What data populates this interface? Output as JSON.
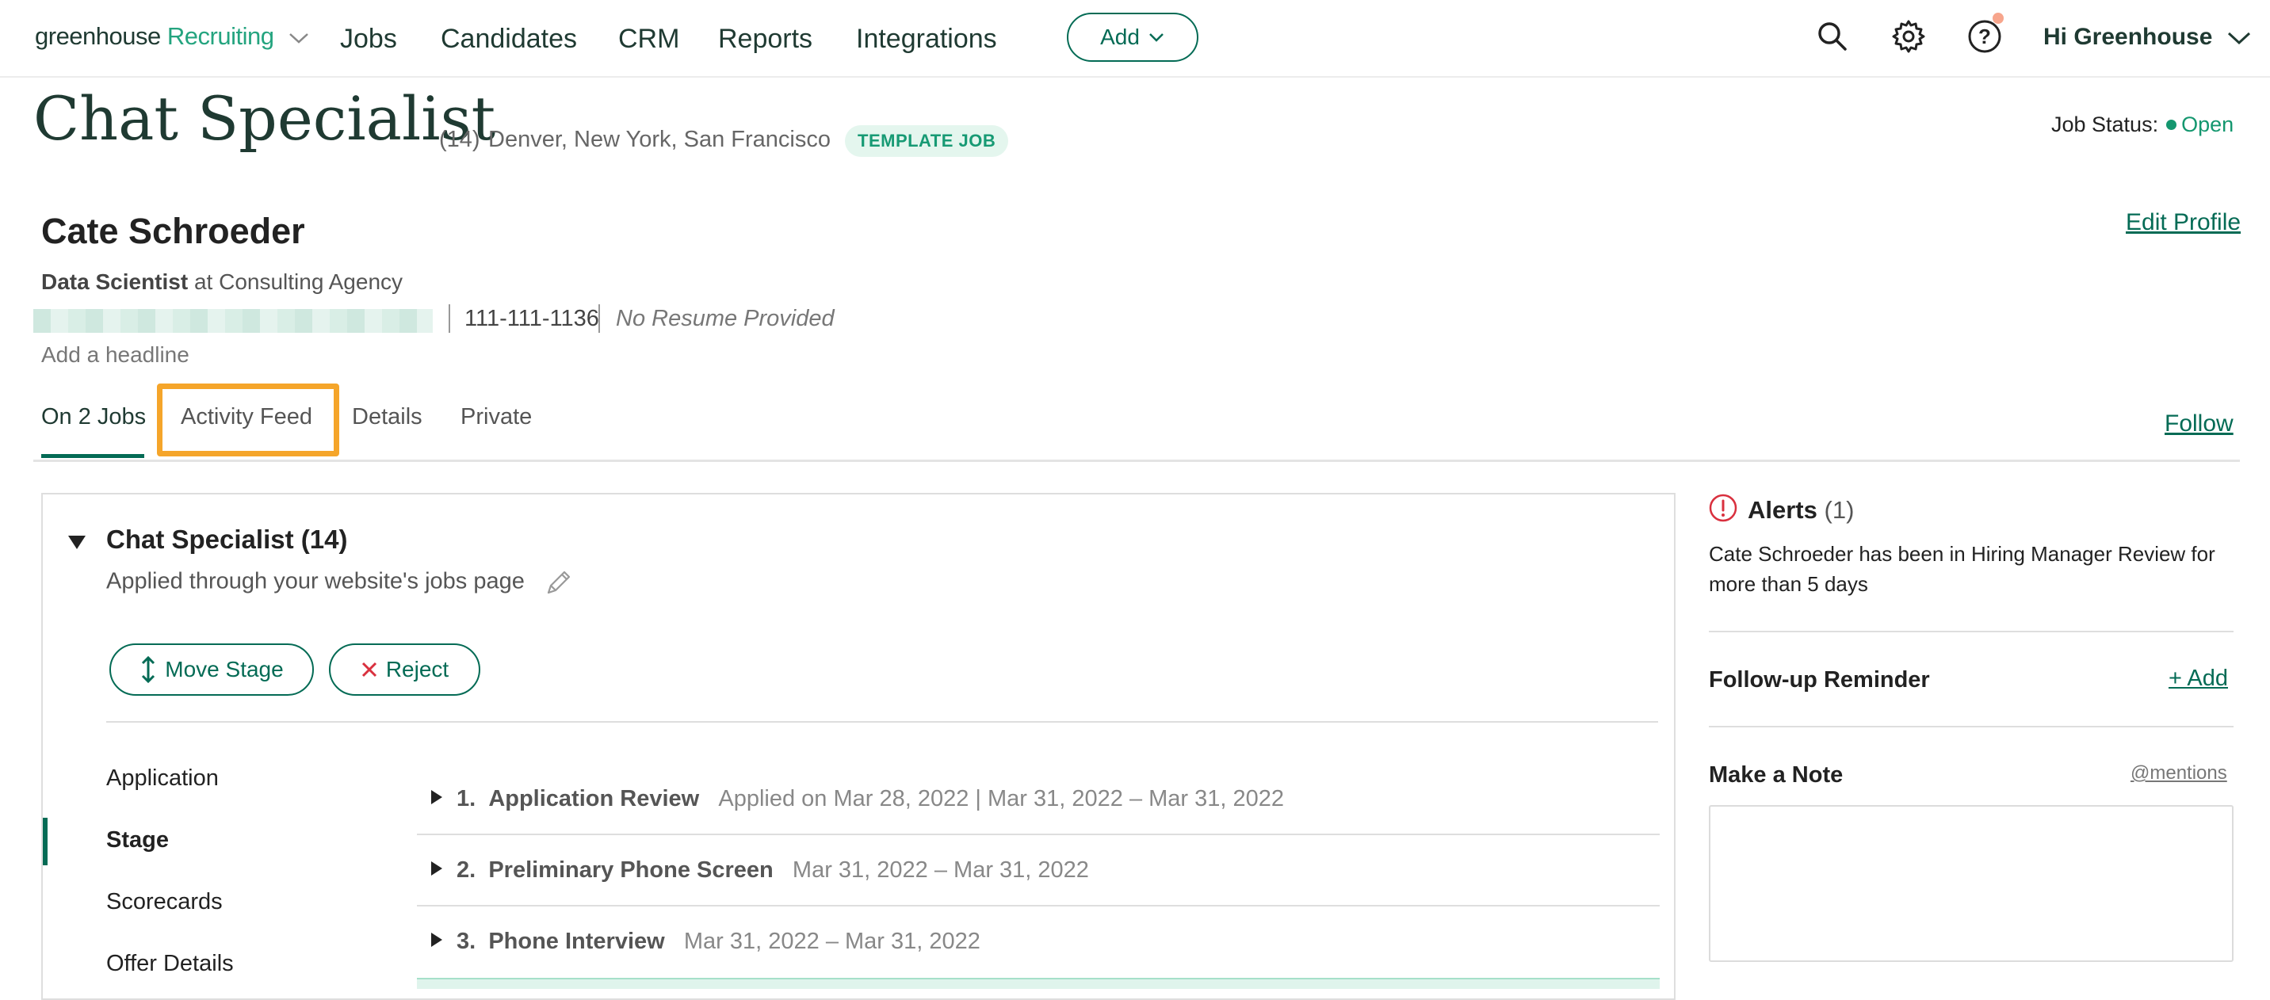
{
  "nav": {
    "logo_main": "greenhouse",
    "logo_product": "Recruiting",
    "links": [
      "Jobs",
      "Candidates",
      "CRM",
      "Reports",
      "Integrations"
    ],
    "add_label": "Add",
    "greeting": "Hi Greenhouse",
    "icons": [
      "search-icon",
      "gear-icon",
      "help-icon"
    ],
    "notification_dot_color": "#f7a58c"
  },
  "job": {
    "title": "Chat Specialist",
    "count": "(14)",
    "locations": "Denver, New York, San Francisco",
    "badge": "TEMPLATE JOB",
    "status_label": "Job Status:",
    "status_value": "Open"
  },
  "candidate": {
    "name": "Cate Schroeder",
    "role": "Data Scientist",
    "at": "at",
    "company": "Consulting Agency",
    "phone": "111-111-1136",
    "resume": "No Resume Provided",
    "headline_placeholder": "Add a headline",
    "edit_profile": "Edit Profile"
  },
  "tabs": {
    "items": [
      "On 2 Jobs",
      "Activity Feed",
      "Details",
      "Private"
    ],
    "active": "On 2 Jobs",
    "highlighted": "Activity Feed",
    "follow": "Follow"
  },
  "application": {
    "title": "Chat Specialist (14)",
    "source": "Applied through your website's jobs page",
    "move_stage": "Move Stage",
    "reject": "Reject",
    "sidenav": [
      "Application",
      "Stage",
      "Scorecards",
      "Offer Details"
    ],
    "sidenav_active": "Stage",
    "stages": [
      {
        "num": "1.",
        "name": "Application Review",
        "date": "Applied on Mar 28, 2022 | Mar 31, 2022 – Mar 31, 2022"
      },
      {
        "num": "2.",
        "name": "Preliminary Phone Screen",
        "date": "Mar 31, 2022 – Mar 31, 2022"
      },
      {
        "num": "3.",
        "name": "Phone Interview",
        "date": "Mar 31, 2022 – Mar 31, 2022"
      }
    ]
  },
  "right": {
    "alerts_title": "Alerts",
    "alerts_count": "(1)",
    "alert_text": "Cate Schroeder has been in Hiring Manager Review for more than 5 days",
    "followup_label": "Follow-up Reminder",
    "followup_add": "+ Add",
    "note_label": "Make a Note",
    "mentions": "@mentions"
  },
  "colors": {
    "brand_green": "#046b55",
    "accent_green": "#24a47f",
    "highlight": "#f5a52a",
    "alert_red": "#d9303e"
  }
}
